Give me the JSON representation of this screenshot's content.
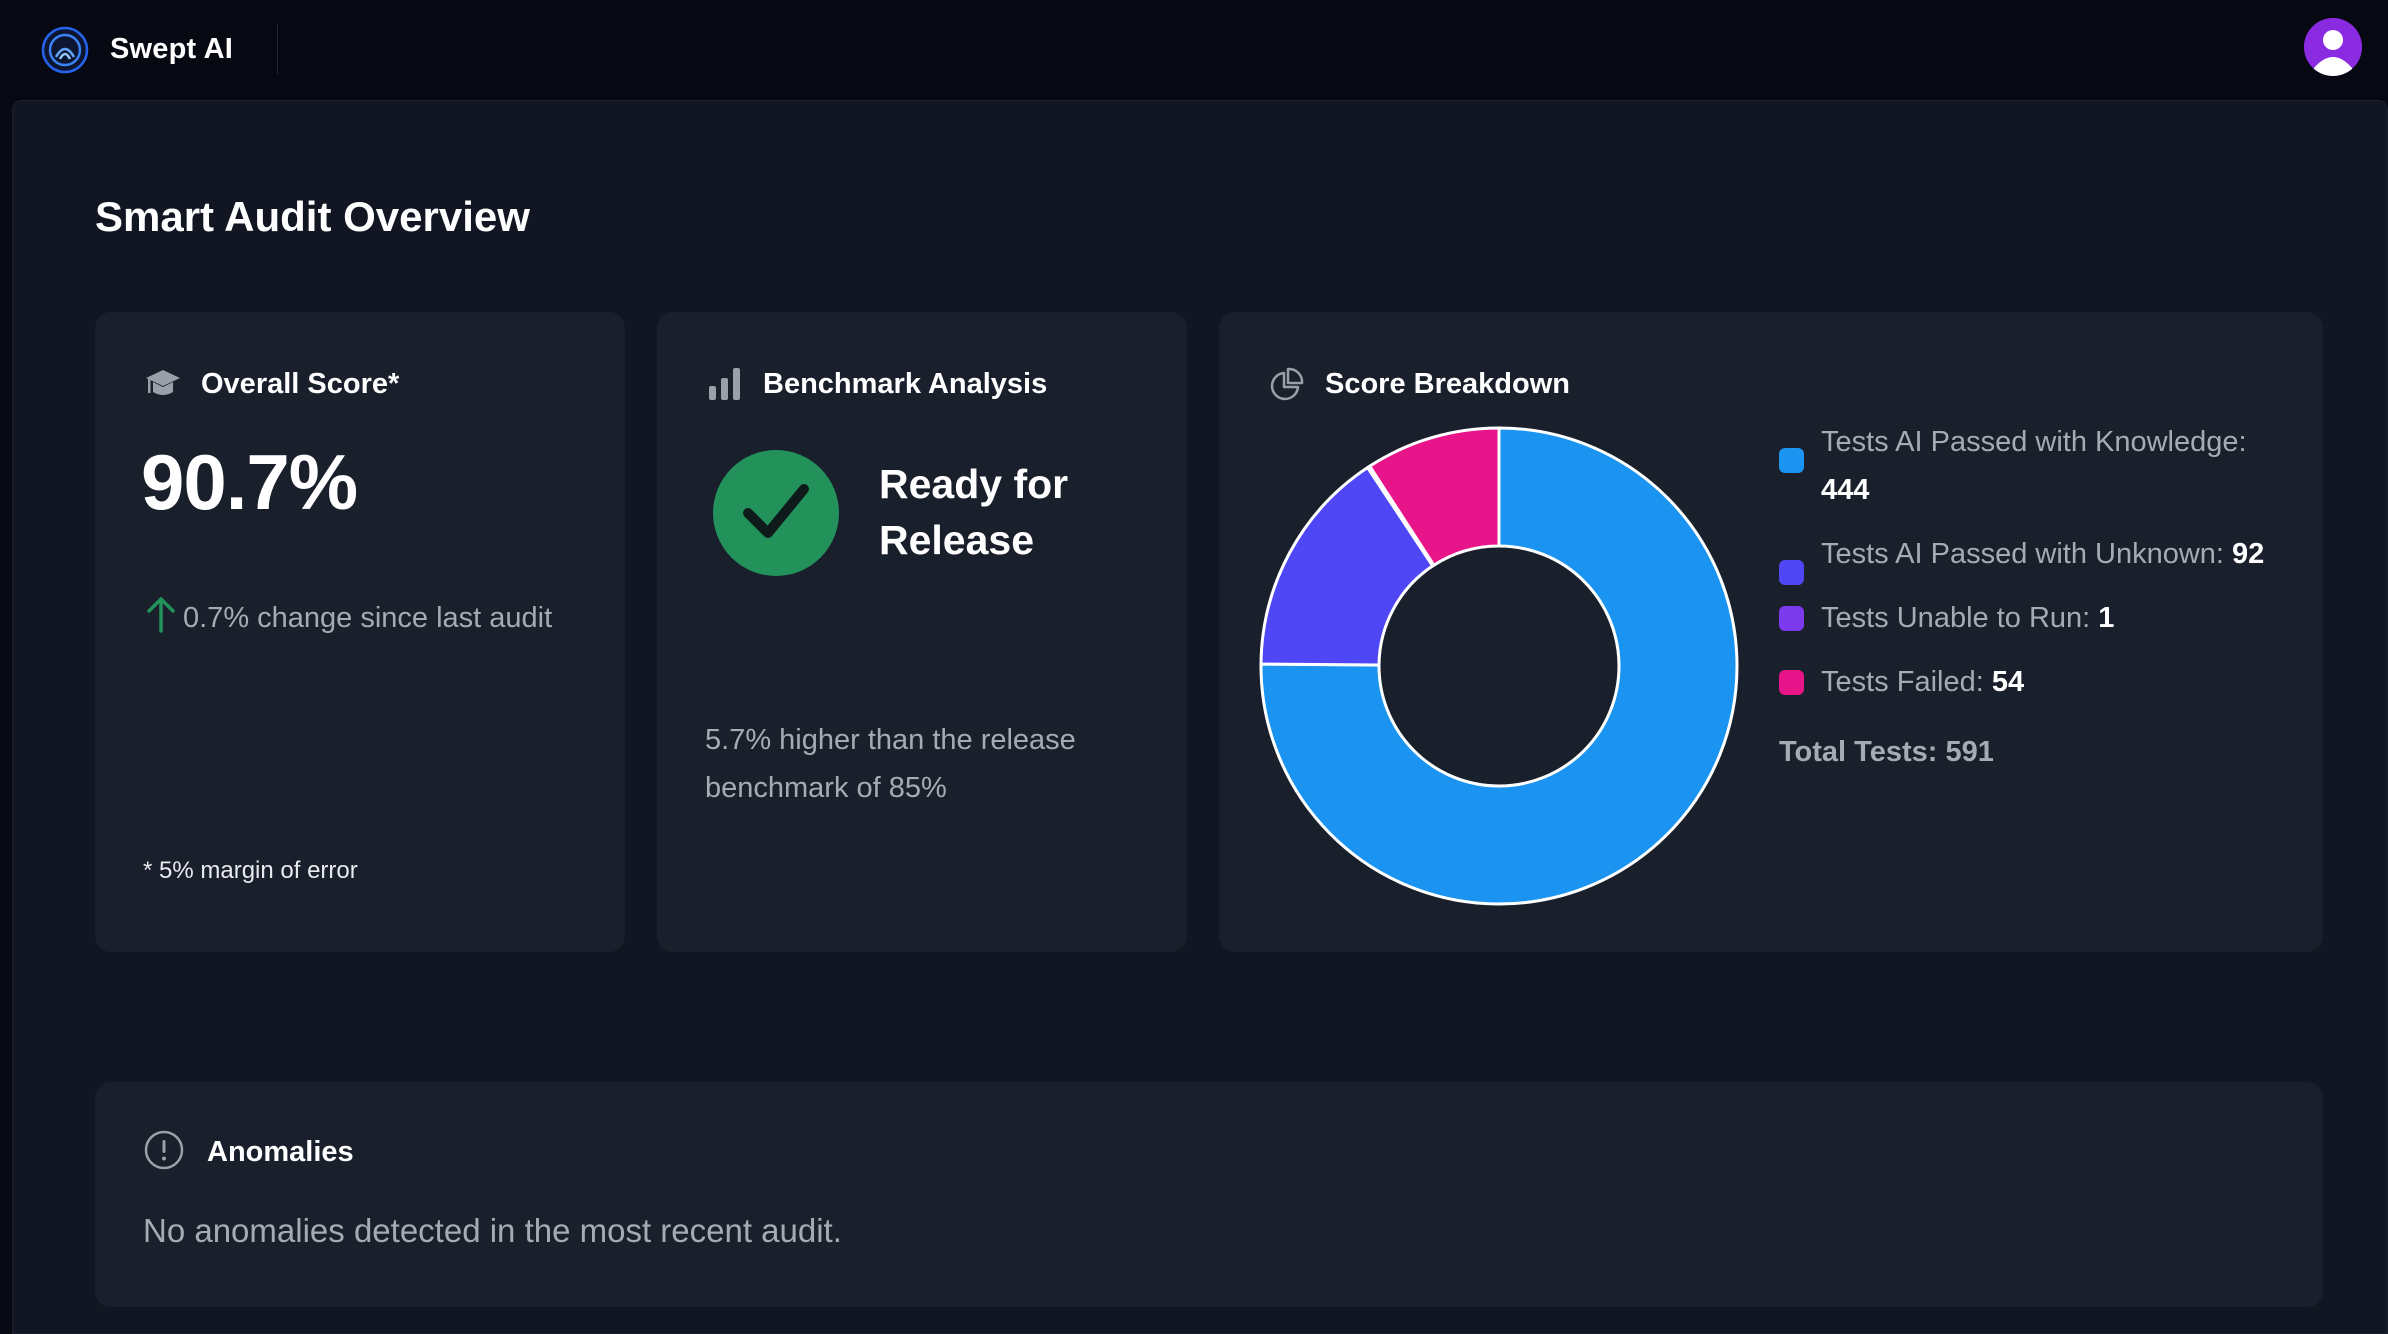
{
  "app": {
    "brand_name": "Swept AI",
    "logo_icon": "swept-ai-logo-icon",
    "avatar_icon": "user-avatar-icon",
    "colors": {
      "background": "#070a12",
      "panel": "#111622",
      "card": "#1a1f2c",
      "avatar": "#8a2be2",
      "success": "#22915a"
    }
  },
  "page": {
    "title": "Smart Audit Overview"
  },
  "overall_score": {
    "heading": "Overall Score*",
    "icon": "graduation-cap-icon",
    "value": "90.7%",
    "change_text": "0.7% change since last audit",
    "change_icon": "arrow-up-icon",
    "change_color": "#22915a",
    "note": "* 5% margin of error"
  },
  "benchmark": {
    "heading": "Benchmark Analysis",
    "icon": "bar-chart-icon",
    "status_icon": "checkmark-icon",
    "status": "Ready for Release",
    "description": "5.7% higher than the release benchmark of 85%"
  },
  "breakdown": {
    "heading": "Score Breakdown",
    "icon": "pie-chart-icon",
    "legend": [
      {
        "label": "Tests AI Passed with Knowledge: ",
        "value": "444",
        "color": "#1a94f0"
      },
      {
        "label": "Tests AI Passed with Unknown: ",
        "value": "92",
        "color": "#4f46f5"
      },
      {
        "label": "Tests Unable to Run: ",
        "value": "1",
        "color": "#7c3aed"
      },
      {
        "label": "Tests Failed: ",
        "value": "54",
        "color": "#e8158a"
      }
    ],
    "total_label": "Total Tests: ",
    "total_value": "591"
  },
  "chart_data": {
    "type": "pie",
    "categories": [
      "Tests AI Passed with Knowledge",
      "Tests AI Passed with Unknown",
      "Tests Unable to Run",
      "Tests Failed"
    ],
    "values": [
      444,
      92,
      1,
      54
    ],
    "colors": [
      "#1a94f0",
      "#4f46f5",
      "#7c3aed",
      "#e8158a"
    ],
    "donut": true,
    "legend": "right"
  },
  "anomalies": {
    "heading": "Anomalies",
    "icon": "alert-circle-icon",
    "text": "No anomalies detected in the most recent audit."
  }
}
